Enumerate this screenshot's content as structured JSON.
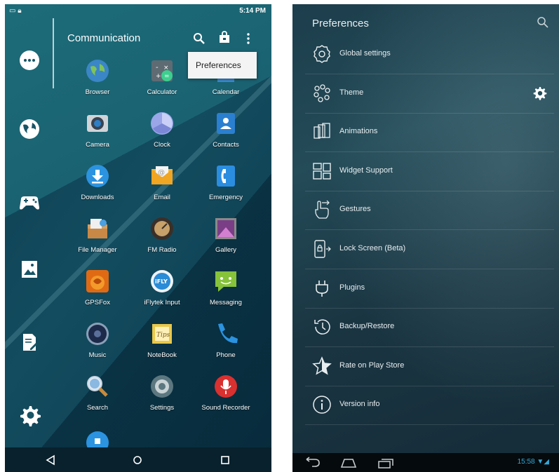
{
  "left": {
    "status_time": "5:14 PM",
    "header_title": "Communication",
    "menu_item": "Preferences",
    "apps": [
      {
        "label": "Browser",
        "icon": "globe-icon",
        "color": "#3b86c6"
      },
      {
        "label": "Calculator",
        "icon": "calculator-icon",
        "color": "#5f6b73"
      },
      {
        "label": "Calendar",
        "icon": "calendar-icon",
        "color": "#3a8bd1"
      },
      {
        "label": "Camera",
        "icon": "camera-icon",
        "color": "#d0d4d8"
      },
      {
        "label": "Clock",
        "icon": "clock-icon",
        "color": "#9aa6e8"
      },
      {
        "label": "Contacts",
        "icon": "contacts-icon",
        "color": "#2b7fd0"
      },
      {
        "label": "Downloads",
        "icon": "download-icon",
        "color": "#2b93e0"
      },
      {
        "label": "Email",
        "icon": "email-icon",
        "color": "#f2b53a"
      },
      {
        "label": "Emergency",
        "icon": "phone-emergency-icon",
        "color": "#2b8de0"
      },
      {
        "label": "File Manager",
        "icon": "file-manager-icon",
        "color": "#d7a060"
      },
      {
        "label": "FM Radio",
        "icon": "radio-icon",
        "color": "#3a2f28"
      },
      {
        "label": "Gallery",
        "icon": "gallery-icon",
        "color": "#7a3e86"
      },
      {
        "label": "GPSFox",
        "icon": "gpsfox-icon",
        "color": "#e06a14"
      },
      {
        "label": "iFlytek Input",
        "icon": "iflytek-icon",
        "color": "#2a8bd6"
      },
      {
        "label": "Messaging",
        "icon": "messaging-icon",
        "color": "#86c23a"
      },
      {
        "label": "Music",
        "icon": "music-icon",
        "color": "#1d2a4a"
      },
      {
        "label": "NoteBook",
        "icon": "notebook-icon",
        "color": "#e9c84a"
      },
      {
        "label": "Phone",
        "icon": "phone-icon",
        "color": "#2b93e0"
      },
      {
        "label": "Search",
        "icon": "search-app-icon",
        "color": "#8ab8e0"
      },
      {
        "label": "Settings",
        "icon": "settings-app-icon",
        "color": "#5c7780"
      },
      {
        "label": "Sound Recorder",
        "icon": "recorder-icon",
        "color": "#d93030"
      }
    ]
  },
  "right": {
    "header_title": "Preferences",
    "items": [
      {
        "label": "Global settings",
        "icon": "global-settings-icon"
      },
      {
        "label": "Theme",
        "icon": "theme-icon"
      },
      {
        "label": "Animations",
        "icon": "animations-icon"
      },
      {
        "label": "Widget Support",
        "icon": "widget-icon"
      },
      {
        "label": "Gestures",
        "icon": "gesture-icon"
      },
      {
        "label": "Lock Screen (Beta)",
        "icon": "lock-screen-icon"
      },
      {
        "label": "Plugins",
        "icon": "plug-icon"
      },
      {
        "label": "Backup/Restore",
        "icon": "backup-icon"
      },
      {
        "label": "Rate on Play Store",
        "icon": "star-icon"
      },
      {
        "label": "Version info",
        "icon": "info-icon"
      }
    ],
    "clock": "15:58"
  }
}
